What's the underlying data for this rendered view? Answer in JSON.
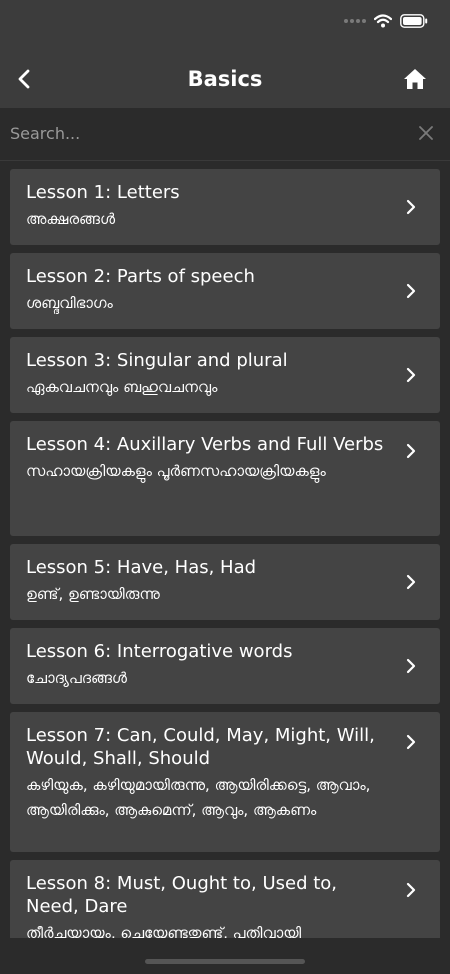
{
  "header": {
    "title": "Basics"
  },
  "search": {
    "placeholder": "Search..."
  },
  "lessons": [
    {
      "title": "Lesson 1: Letters",
      "subtitle": "അക്ഷരങ്ങൾ"
    },
    {
      "title": "Lesson 2: Parts of speech",
      "subtitle": "ശബ്ദവിഭാഗം"
    },
    {
      "title": "Lesson 3: Singular and plural",
      "subtitle": "ഏകവചനവും ബഹുവചനവും"
    },
    {
      "title": "Lesson 4: Auxillary Verbs and Full Verbs",
      "subtitle": "സഹായക്രിയകളും പൂർണസഹായക്രിയകളും"
    },
    {
      "title": "Lesson 5: Have, Has, Had",
      "subtitle": "ഉണ്ട്, ഉണ്ടായിരുന്നു"
    },
    {
      "title": "Lesson 6: Interrogative words",
      "subtitle": "ചോദ്യപദങ്ങൾ"
    },
    {
      "title": "Lesson 7: Can, Could, May, Might, Will, Would, Shall, Should",
      "subtitle": "കഴിയുക, കഴിയുമായിരുന്നു, ആയിരിക്കട്ടെ, ആവാം, ആയിരിക്കും, ആകുമെന്ന്, ആവും, ആകണം"
    },
    {
      "title": "Lesson 8: Must, Ought to, Used to, Need, Dare",
      "subtitle": "തീർച്ചയായും, ചെയ്യേണ്ടതുണ്ട്, പതിവായി"
    }
  ],
  "icons": {
    "back": "chevron-left-icon",
    "home": "home-icon",
    "clear": "close-icon",
    "row": "chevron-right-icon",
    "signal": "signal-icon",
    "wifi": "wifi-icon",
    "battery": "battery-icon"
  }
}
